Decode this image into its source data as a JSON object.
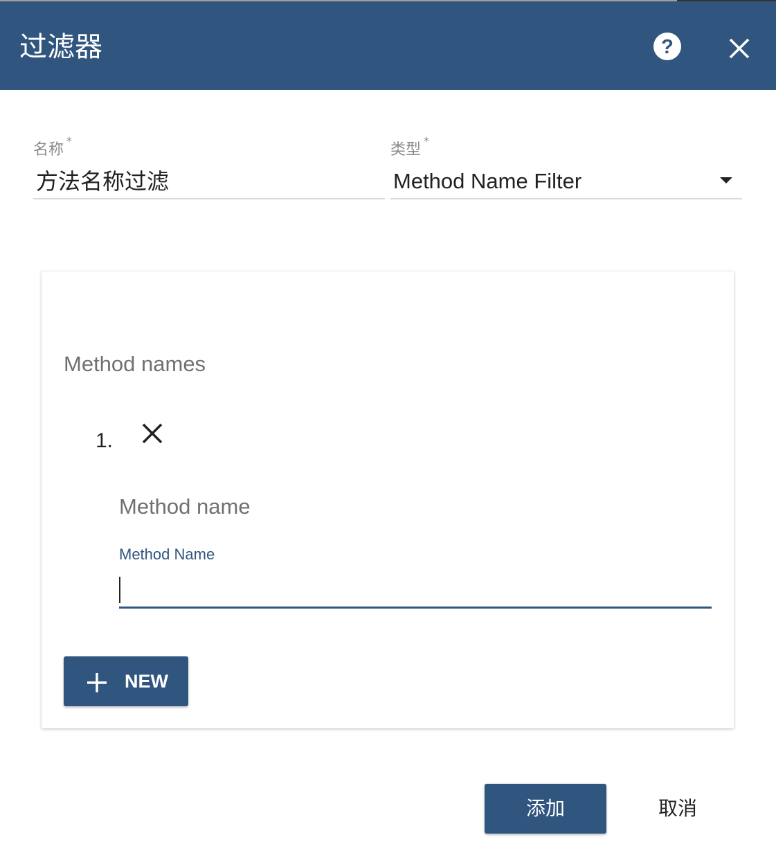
{
  "dialog": {
    "title": "过滤器",
    "help_icon": "help-circle-icon",
    "close_icon": "close-icon"
  },
  "form": {
    "name": {
      "label": "名称",
      "required_mark": "*",
      "value": "方法名称过滤"
    },
    "type": {
      "label": "类型",
      "required_mark": "*",
      "value": "Method Name Filter",
      "icon": "dropdown-arrow-icon"
    }
  },
  "method_names": {
    "title": "Method names",
    "items": [
      {
        "number": "1.",
        "remove_icon": "close-icon",
        "subtitle": "Method name",
        "field_label": "Method Name",
        "value": ""
      }
    ],
    "new_button": {
      "label": "NEW",
      "icon": "plus-icon"
    }
  },
  "actions": {
    "add_label": "添加",
    "cancel_label": "取消"
  },
  "colors": {
    "primary": "#30557f",
    "muted_text": "#707070",
    "divider": "#d9d9d9"
  }
}
